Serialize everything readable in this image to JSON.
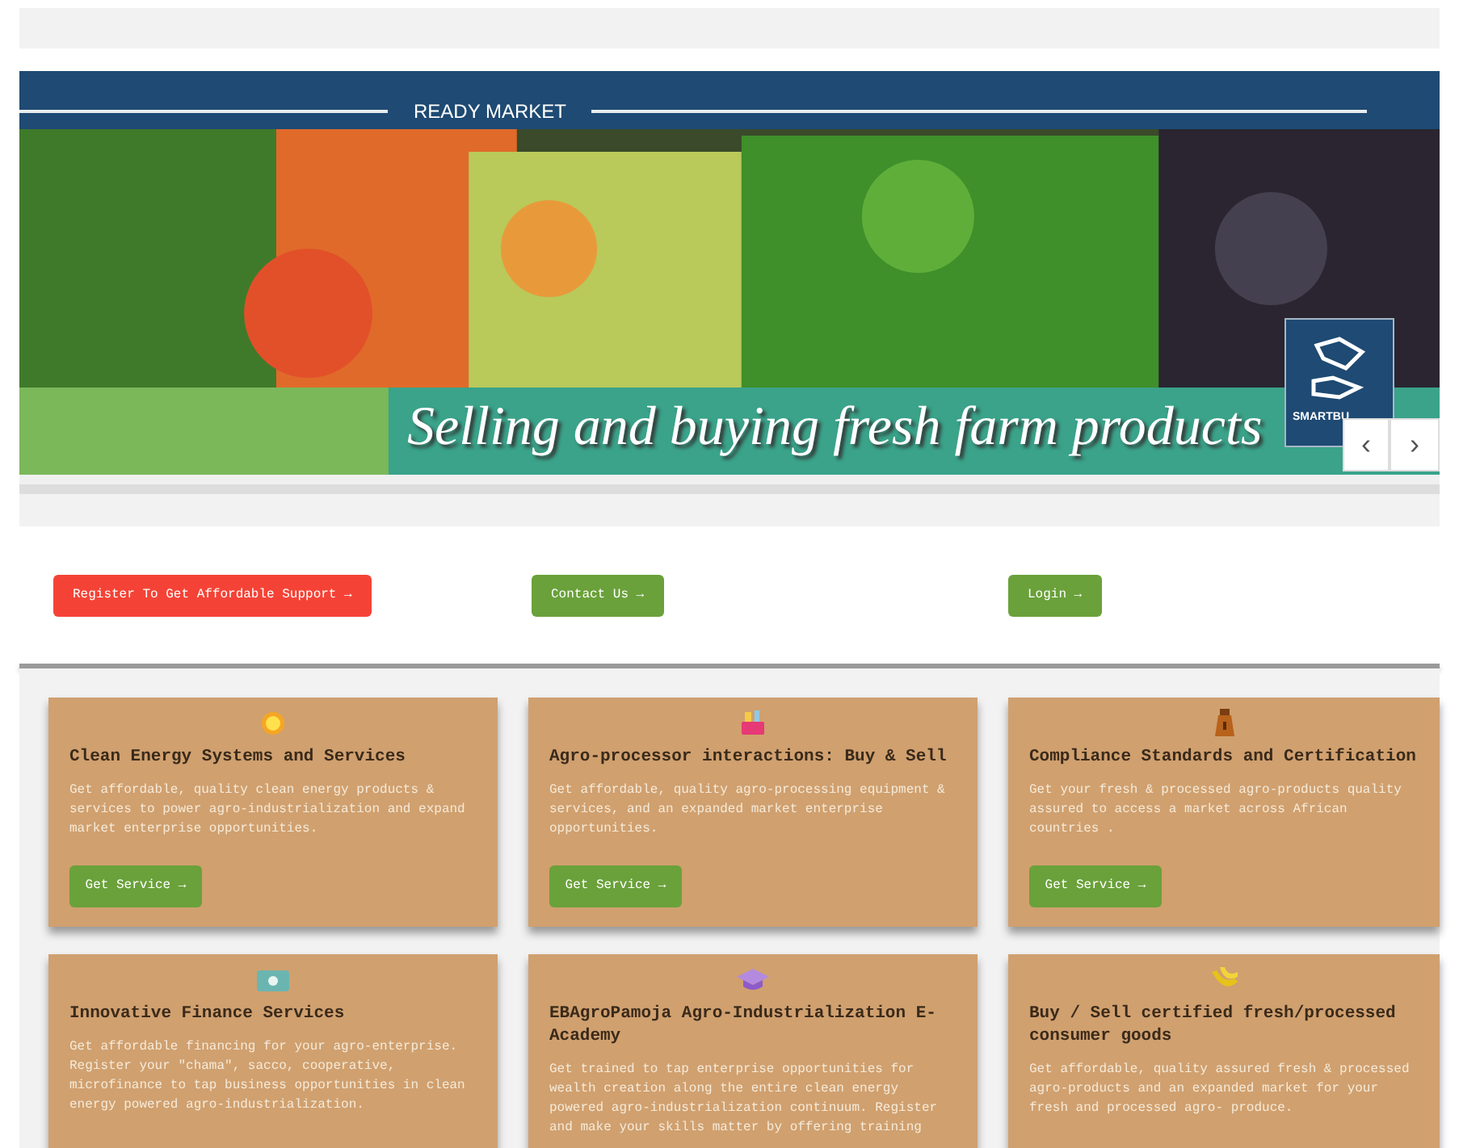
{
  "banner": {
    "label": "READY MARKET",
    "headline": "Selling and buying fresh farm products",
    "logo_text": "SMARTBU",
    "prev": "‹",
    "next": "›"
  },
  "actions": [
    {
      "label": "Register To Get Affordable Support →",
      "kind": "danger"
    },
    {
      "label": "Contact Us →",
      "kind": "primary"
    },
    {
      "label": "Login →",
      "kind": "primary"
    }
  ],
  "services": [
    {
      "kind": "sun",
      "title": "Clean Energy Systems and Services",
      "text": "Get affordable, quality clean energy products & services to power agro-industrialization and expand market enterprise opportunities.",
      "button": "Get Service →"
    },
    {
      "kind": "basket",
      "title": "Agro-processor interactions: Buy & Sell",
      "text": "Get affordable, quality agro-processing equipment & services, and an expanded market enterprise opportunities.",
      "button": "Get Service →"
    },
    {
      "kind": "sack",
      "title": "Compliance Standards and Certification",
      "text": "Get your fresh & processed agro-products quality assured to access a market across African countries .",
      "button": "Get Service →"
    },
    {
      "kind": "money",
      "title": "Innovative Finance Services",
      "text": "Get affordable financing for your agro-enterprise. Register your \"chama\", sacco, cooperative, microfinance to tap business opportunities in clean energy powered agro-industrialization."
    },
    {
      "kind": "cap",
      "title": "EBAgroPamoja Agro-Industrialization E-Academy",
      "text": "Get trained to tap enterprise opportunities for wealth creation along the entire clean energy powered agro-industrialization continuum. Register and make your skills matter by offering training"
    },
    {
      "kind": "banana",
      "title": "Buy / Sell certified fresh/processed consumer goods",
      "text": "Get affordable, quality assured fresh & processed agro-products and an expanded market for your fresh and processed agro- produce."
    }
  ]
}
